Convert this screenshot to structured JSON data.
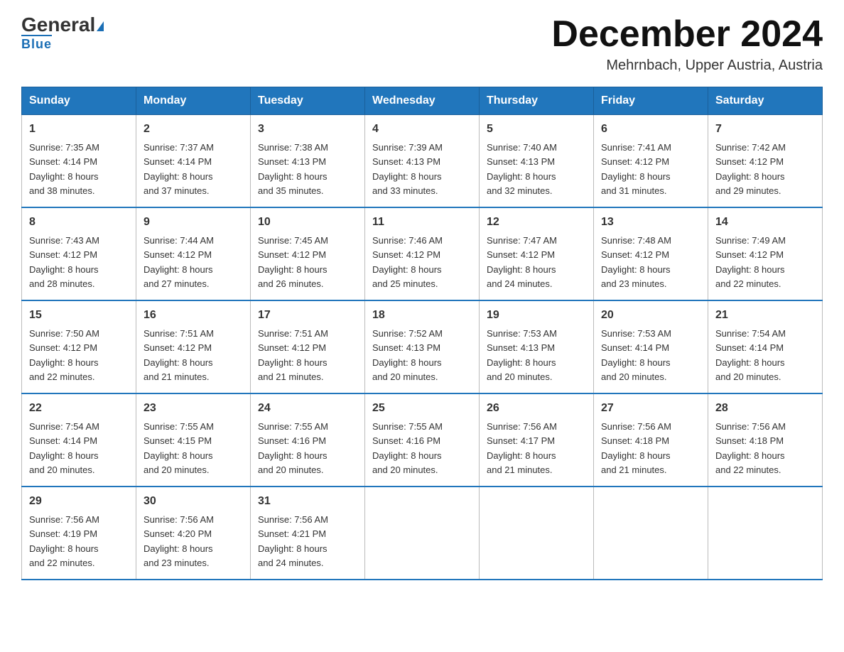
{
  "header": {
    "logo_general": "General",
    "logo_blue": "Blue",
    "month_title": "December 2024",
    "subtitle": "Mehrnbach, Upper Austria, Austria"
  },
  "days_of_week": [
    "Sunday",
    "Monday",
    "Tuesday",
    "Wednesday",
    "Thursday",
    "Friday",
    "Saturday"
  ],
  "weeks": [
    [
      {
        "day": "1",
        "sunrise": "7:35 AM",
        "sunset": "4:14 PM",
        "daylight": "8 hours and 38 minutes."
      },
      {
        "day": "2",
        "sunrise": "7:37 AM",
        "sunset": "4:14 PM",
        "daylight": "8 hours and 37 minutes."
      },
      {
        "day": "3",
        "sunrise": "7:38 AM",
        "sunset": "4:13 PM",
        "daylight": "8 hours and 35 minutes."
      },
      {
        "day": "4",
        "sunrise": "7:39 AM",
        "sunset": "4:13 PM",
        "daylight": "8 hours and 33 minutes."
      },
      {
        "day": "5",
        "sunrise": "7:40 AM",
        "sunset": "4:13 PM",
        "daylight": "8 hours and 32 minutes."
      },
      {
        "day": "6",
        "sunrise": "7:41 AM",
        "sunset": "4:12 PM",
        "daylight": "8 hours and 31 minutes."
      },
      {
        "day": "7",
        "sunrise": "7:42 AM",
        "sunset": "4:12 PM",
        "daylight": "8 hours and 29 minutes."
      }
    ],
    [
      {
        "day": "8",
        "sunrise": "7:43 AM",
        "sunset": "4:12 PM",
        "daylight": "8 hours and 28 minutes."
      },
      {
        "day": "9",
        "sunrise": "7:44 AM",
        "sunset": "4:12 PM",
        "daylight": "8 hours and 27 minutes."
      },
      {
        "day": "10",
        "sunrise": "7:45 AM",
        "sunset": "4:12 PM",
        "daylight": "8 hours and 26 minutes."
      },
      {
        "day": "11",
        "sunrise": "7:46 AM",
        "sunset": "4:12 PM",
        "daylight": "8 hours and 25 minutes."
      },
      {
        "day": "12",
        "sunrise": "7:47 AM",
        "sunset": "4:12 PM",
        "daylight": "8 hours and 24 minutes."
      },
      {
        "day": "13",
        "sunrise": "7:48 AM",
        "sunset": "4:12 PM",
        "daylight": "8 hours and 23 minutes."
      },
      {
        "day": "14",
        "sunrise": "7:49 AM",
        "sunset": "4:12 PM",
        "daylight": "8 hours and 22 minutes."
      }
    ],
    [
      {
        "day": "15",
        "sunrise": "7:50 AM",
        "sunset": "4:12 PM",
        "daylight": "8 hours and 22 minutes."
      },
      {
        "day": "16",
        "sunrise": "7:51 AM",
        "sunset": "4:12 PM",
        "daylight": "8 hours and 21 minutes."
      },
      {
        "day": "17",
        "sunrise": "7:51 AM",
        "sunset": "4:12 PM",
        "daylight": "8 hours and 21 minutes."
      },
      {
        "day": "18",
        "sunrise": "7:52 AM",
        "sunset": "4:13 PM",
        "daylight": "8 hours and 20 minutes."
      },
      {
        "day": "19",
        "sunrise": "7:53 AM",
        "sunset": "4:13 PM",
        "daylight": "8 hours and 20 minutes."
      },
      {
        "day": "20",
        "sunrise": "7:53 AM",
        "sunset": "4:14 PM",
        "daylight": "8 hours and 20 minutes."
      },
      {
        "day": "21",
        "sunrise": "7:54 AM",
        "sunset": "4:14 PM",
        "daylight": "8 hours and 20 minutes."
      }
    ],
    [
      {
        "day": "22",
        "sunrise": "7:54 AM",
        "sunset": "4:14 PM",
        "daylight": "8 hours and 20 minutes."
      },
      {
        "day": "23",
        "sunrise": "7:55 AM",
        "sunset": "4:15 PM",
        "daylight": "8 hours and 20 minutes."
      },
      {
        "day": "24",
        "sunrise": "7:55 AM",
        "sunset": "4:16 PM",
        "daylight": "8 hours and 20 minutes."
      },
      {
        "day": "25",
        "sunrise": "7:55 AM",
        "sunset": "4:16 PM",
        "daylight": "8 hours and 20 minutes."
      },
      {
        "day": "26",
        "sunrise": "7:56 AM",
        "sunset": "4:17 PM",
        "daylight": "8 hours and 21 minutes."
      },
      {
        "day": "27",
        "sunrise": "7:56 AM",
        "sunset": "4:18 PM",
        "daylight": "8 hours and 21 minutes."
      },
      {
        "day": "28",
        "sunrise": "7:56 AM",
        "sunset": "4:18 PM",
        "daylight": "8 hours and 22 minutes."
      }
    ],
    [
      {
        "day": "29",
        "sunrise": "7:56 AM",
        "sunset": "4:19 PM",
        "daylight": "8 hours and 22 minutes."
      },
      {
        "day": "30",
        "sunrise": "7:56 AM",
        "sunset": "4:20 PM",
        "daylight": "8 hours and 23 minutes."
      },
      {
        "day": "31",
        "sunrise": "7:56 AM",
        "sunset": "4:21 PM",
        "daylight": "8 hours and 24 minutes."
      },
      null,
      null,
      null,
      null
    ]
  ],
  "labels": {
    "sunrise": "Sunrise:",
    "sunset": "Sunset:",
    "daylight": "Daylight:"
  }
}
